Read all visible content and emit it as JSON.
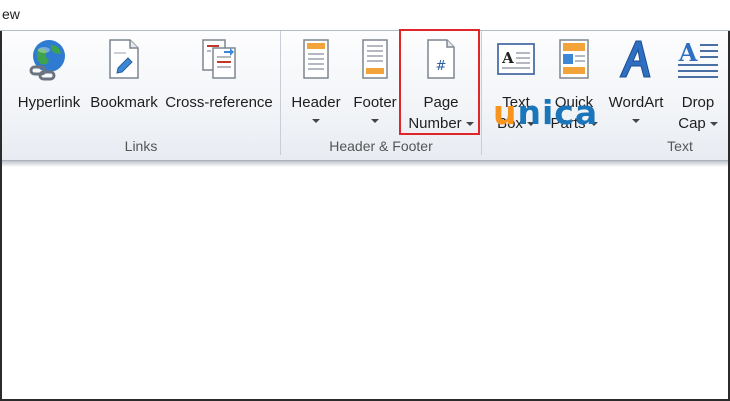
{
  "tab": {
    "label": "ew"
  },
  "groups": {
    "links": {
      "label": "Links",
      "hyperlink": "Hyperlink",
      "bookmark": "Bookmark",
      "cross_reference": "Cross-reference"
    },
    "header_footer": {
      "label": "Header & Footer",
      "header": "Header",
      "footer": "Footer",
      "page_number_line1": "Page",
      "page_number_line2": "Number"
    },
    "text": {
      "label": "Text",
      "text_box_line1": "Text",
      "text_box_line2": "Box",
      "quick_parts_line1": "Quick",
      "quick_parts_line2": "Parts",
      "wordart": "WordArt",
      "drop_cap_line1": "Drop",
      "drop_cap_line2": "Cap"
    }
  },
  "watermark": {
    "u": "u",
    "nica": "nica"
  },
  "colors": {
    "highlight": "#e0252b",
    "watermark_orange": "#f7941d",
    "watermark_blue": "#1b75bb"
  },
  "icons": [
    "globe-chain-icon",
    "bookmark-page-icon",
    "cross-reference-icon",
    "header-icon",
    "footer-icon",
    "page-number-icon",
    "text-box-icon",
    "quick-parts-icon",
    "wordart-icon",
    "drop-cap-icon"
  ]
}
